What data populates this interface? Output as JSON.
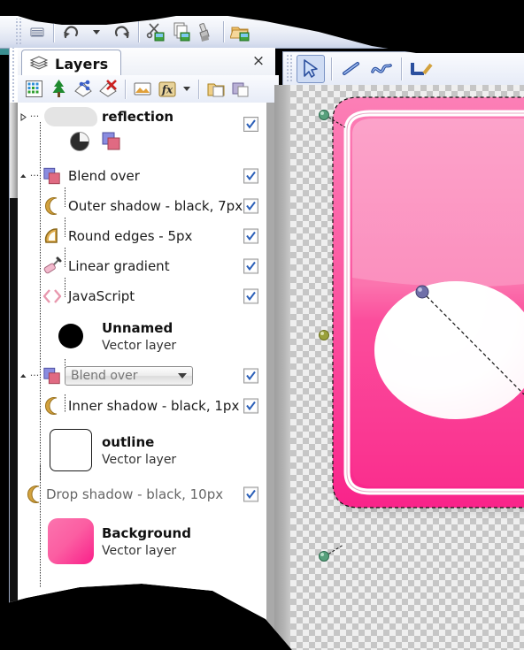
{
  "window": {
    "accent_blue": "#2b5fb8",
    "panel_bg": "#ffffff",
    "toolbar_gradient_top": "#fbfcfe",
    "toolbar_gradient_bottom": "#ccd5ea"
  },
  "main_toolbar": {
    "buttons": [
      {
        "name": "new-document",
        "icon": "document-icon",
        "tooltip": "New"
      },
      {
        "name": "undo",
        "icon": "undo-arrow-icon",
        "tooltip": "Undo"
      },
      {
        "name": "undo-history",
        "icon": "chevron-down-icon",
        "tooltip": "Undo history"
      },
      {
        "name": "redo",
        "icon": "redo-arrow-icon",
        "tooltip": "Redo"
      },
      {
        "name": "cut",
        "icon": "scissors-icon",
        "tooltip": "Cut"
      },
      {
        "name": "copy",
        "icon": "copy-pages-icon",
        "tooltip": "Copy"
      },
      {
        "name": "paste",
        "icon": "paint-brush-icon",
        "tooltip": "Paste"
      },
      {
        "name": "open-folder",
        "icon": "folder-image-icon",
        "tooltip": "Open"
      }
    ]
  },
  "panel": {
    "tab_label": "Layers",
    "tab_icon": "layers-stack-icon",
    "close_label": "×",
    "toolbar_buttons": [
      {
        "name": "new-raster-layer",
        "icon": "pixel-grid-icon"
      },
      {
        "name": "new-vector-layer",
        "icon": "tree-icon"
      },
      {
        "name": "duplicate-layer",
        "icon": "share-layer-icon"
      },
      {
        "name": "delete-layer",
        "icon": "delete-layer-icon"
      },
      {
        "name": "layer-image",
        "icon": "image-layer-icon"
      },
      {
        "name": "layer-effects",
        "icon": "fx-icon"
      },
      {
        "name": "layer-effects-menu",
        "icon": "chevron-down-icon"
      },
      {
        "name": "group-layers",
        "icon": "folder-layer-icon"
      },
      {
        "name": "merge-layers",
        "icon": "merge-layer-icon"
      }
    ]
  },
  "layers": [
    {
      "kind": "layer",
      "name": "reflection",
      "sublabel": "",
      "thumb": "reflection-blob-thumb",
      "checked": true,
      "indent": 0,
      "twisty": "collapsed",
      "extra_icons": [
        "opacity-pie-icon",
        "blend-mode-icon"
      ]
    },
    {
      "kind": "effect-group",
      "name": "Blend over",
      "icon": "blend-mode-icon",
      "checked": true,
      "indent": 0,
      "twisty": "expanded"
    },
    {
      "kind": "effect",
      "name": "Outer shadow - black, 7px",
      "icon": "crescent-shadow-icon",
      "checked": true,
      "indent": 1
    },
    {
      "kind": "effect",
      "name": "Round edges - 5px",
      "icon": "round-corner-icon",
      "checked": true,
      "indent": 1
    },
    {
      "kind": "effect",
      "name": "Linear gradient",
      "icon": "paint-roller-icon",
      "checked": true,
      "indent": 1
    },
    {
      "kind": "effect",
      "name": "JavaScript",
      "icon": "angle-brackets-icon",
      "checked": true,
      "indent": 1
    },
    {
      "kind": "layer",
      "name": "Unnamed",
      "sublabel": "Vector layer",
      "thumb": "black-circle-thumb",
      "checked": false,
      "indent": 0
    },
    {
      "kind": "effect-group-combo",
      "combo_value": "Blend over",
      "icon": "blend-mode-icon",
      "checked": true,
      "indent": 0,
      "twisty": "expanded"
    },
    {
      "kind": "effect",
      "name": "Inner shadow - black, 1px",
      "icon": "crescent-shadow-icon",
      "checked": true,
      "indent": 1
    },
    {
      "kind": "layer",
      "name": "outline",
      "sublabel": "Vector layer",
      "thumb": "white-rounded-square-thumb",
      "checked": false,
      "indent": 0
    },
    {
      "kind": "effect",
      "name": "Drop shadow - black, 10px",
      "icon": "crescent-shadow-icon",
      "checked": true,
      "indent": 0,
      "dim": true
    },
    {
      "kind": "layer",
      "name": "Background",
      "sublabel": "Vector layer",
      "thumb": "pink-rounded-square-thumb",
      "checked": false,
      "indent": 0
    }
  ],
  "tool_toolbar": {
    "buttons": [
      {
        "name": "select-tool",
        "icon": "arrow-cursor-icon",
        "selected": true
      },
      {
        "name": "line-tool",
        "icon": "line-icon",
        "selected": false
      },
      {
        "name": "curve-tool",
        "icon": "curve-icon",
        "selected": false
      },
      {
        "name": "shape-tool",
        "icon": "polyline-icon",
        "selected": false
      }
    ]
  },
  "canvas": {
    "background": "transparency-checkerboard",
    "shape_fill_outer": "#fb5ea2",
    "shape_fill_inner": "#f96fae",
    "reflection_color": "#ffffff",
    "handles": [
      {
        "name": "node-handle-top",
        "color": "#4f9d7a"
      },
      {
        "name": "node-handle-mid",
        "color": "#8f9933"
      },
      {
        "name": "node-handle-bottom",
        "color": "#4f9d7a"
      },
      {
        "name": "gradient-handle",
        "color": "#6a6aa8"
      }
    ]
  }
}
